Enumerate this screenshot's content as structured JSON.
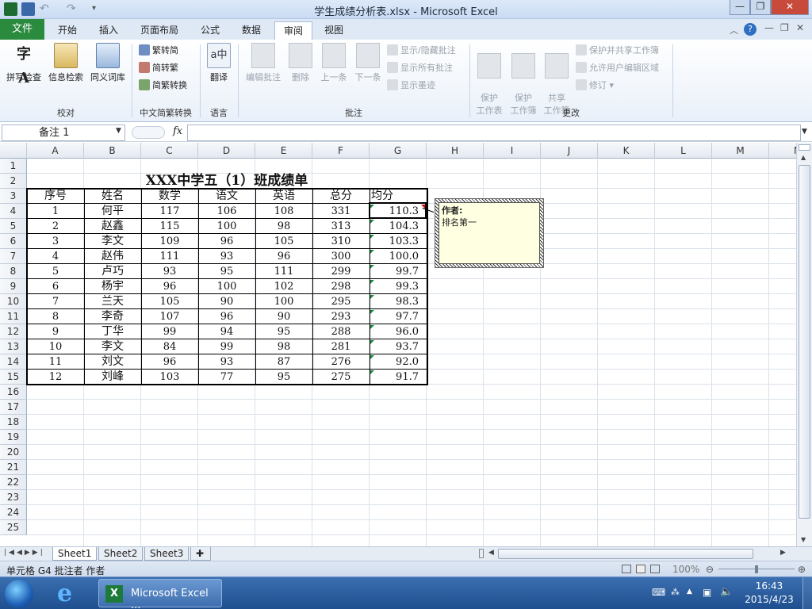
{
  "window": {
    "title": "学生成绩分析表.xlsx - Microsoft Excel"
  },
  "tabs": [
    {
      "label": "文件"
    },
    {
      "label": "开始"
    },
    {
      "label": "插入"
    },
    {
      "label": "页面布局"
    },
    {
      "label": "公式"
    },
    {
      "label": "数据"
    },
    {
      "label": "审阅"
    },
    {
      "label": "视图"
    }
  ],
  "ribbon": {
    "proofing": {
      "spell": "拼写检查",
      "research": "信息检索",
      "thesaurus": "同义词库",
      "label": "校对"
    },
    "chinese": {
      "t2s": "繁转简",
      "s2t": "简转繁",
      "convert": "简繁转换",
      "label": "中文简繁转换"
    },
    "language": {
      "translate": "翻译",
      "label": "语言"
    },
    "comments": {
      "edit": "编辑批注",
      "delete": "删除",
      "prev": "上一条",
      "next": "下一条",
      "show_hide": "显示/隐藏批注",
      "show_all": "显示所有批注",
      "show_ink": "显示墨迹",
      "label": "批注"
    },
    "changes": {
      "protect_sheet": "保护\n工作表",
      "protect_wb": "保护\n工作簿",
      "share_wb": "共享\n工作簿",
      "protect_share": "保护并共享工作簿",
      "allow_edit": "允许用户编辑区域",
      "track": "修订",
      "label": "更改"
    }
  },
  "formula_bar": {
    "name_box": "备注 1",
    "fx": "fx",
    "formula": ""
  },
  "columns": [
    "A",
    "B",
    "C",
    "D",
    "E",
    "F",
    "G",
    "H",
    "I",
    "J",
    "K",
    "L",
    "M",
    "N"
  ],
  "rows": [
    "1",
    "2",
    "3",
    "4",
    "5",
    "6",
    "7",
    "8",
    "9",
    "10",
    "11",
    "12",
    "13",
    "14",
    "15",
    "16",
    "17",
    "18",
    "19",
    "20",
    "21",
    "22",
    "23",
    "24",
    "25"
  ],
  "table": {
    "title": "XXX中学五（1）班成绩单",
    "headers": [
      "序号",
      "姓名",
      "数学",
      "语文",
      "英语",
      "总分",
      "均分"
    ],
    "rows": [
      [
        "1",
        "何平",
        "117",
        "106",
        "108",
        "331",
        "110.3"
      ],
      [
        "2",
        "赵鑫",
        "115",
        "100",
        "98",
        "313",
        "104.3"
      ],
      [
        "3",
        "李文",
        "109",
        "96",
        "105",
        "310",
        "103.3"
      ],
      [
        "4",
        "赵伟",
        "111",
        "93",
        "96",
        "300",
        "100.0"
      ],
      [
        "5",
        "卢巧",
        "93",
        "95",
        "111",
        "299",
        "99.7"
      ],
      [
        "6",
        "杨宇",
        "96",
        "100",
        "102",
        "298",
        "99.3"
      ],
      [
        "7",
        "兰天",
        "105",
        "90",
        "100",
        "295",
        "98.3"
      ],
      [
        "8",
        "李奇",
        "107",
        "96",
        "90",
        "293",
        "97.7"
      ],
      [
        "9",
        "丁华",
        "99",
        "94",
        "95",
        "288",
        "96.0"
      ],
      [
        "10",
        "李文",
        "84",
        "99",
        "98",
        "281",
        "93.7"
      ],
      [
        "11",
        "刘文",
        "96",
        "93",
        "87",
        "276",
        "92.0"
      ],
      [
        "12",
        "刘峰",
        "103",
        "77",
        "95",
        "275",
        "91.7"
      ]
    ]
  },
  "comment": {
    "author": "作者:",
    "text": "排名第一"
  },
  "sheets": [
    {
      "label": "Sheet1"
    },
    {
      "label": "Sheet2"
    },
    {
      "label": "Sheet3"
    }
  ],
  "status": {
    "text": "单元格 G4 批注者 作者",
    "zoom": "100%"
  },
  "taskbar": {
    "app": "Microsoft Excel ...",
    "time": "16:43",
    "date": "2015/4/23"
  },
  "colors": {
    "file_tab": "#2a8a3e",
    "comment_bg": "#ffffe1",
    "taskbar": "#1f4f8f"
  }
}
